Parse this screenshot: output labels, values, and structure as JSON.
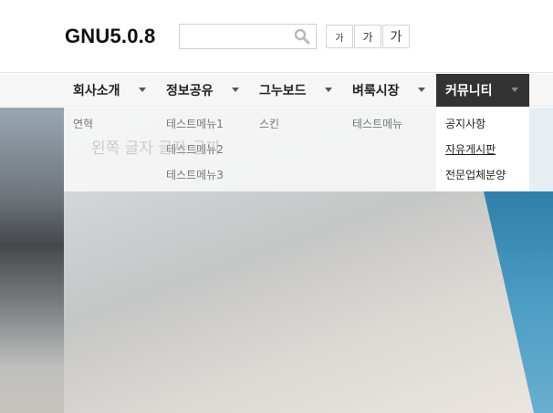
{
  "header": {
    "logo": "GNU5.0.8",
    "search": {
      "value": "",
      "placeholder": "",
      "icon": "search-icon"
    },
    "font_buttons": [
      "가",
      "가",
      "가"
    ]
  },
  "nav": {
    "items": [
      {
        "label": "회사소개",
        "sub": [
          "연혁"
        ]
      },
      {
        "label": "정보공유",
        "sub": [
          "테스트메뉴1",
          "테스트메뉴2",
          "테스트메뉴3"
        ]
      },
      {
        "label": "그누보드",
        "sub": [
          "스킨"
        ]
      },
      {
        "label": "벼룩시장",
        "sub": [
          "테스트메뉴"
        ]
      },
      {
        "label": "커뮤니티",
        "sub": [
          "공지사항",
          "자유게시판",
          "전문업체분양"
        ]
      }
    ],
    "active_index": 4
  },
  "hero": {
    "ghost_text": "왼쪽 글자 글자 글짜"
  },
  "colors": {
    "active_tab_bg": "#333333",
    "nav_bg": "#f6f6f6",
    "hero_accent": "#4a90b8"
  }
}
